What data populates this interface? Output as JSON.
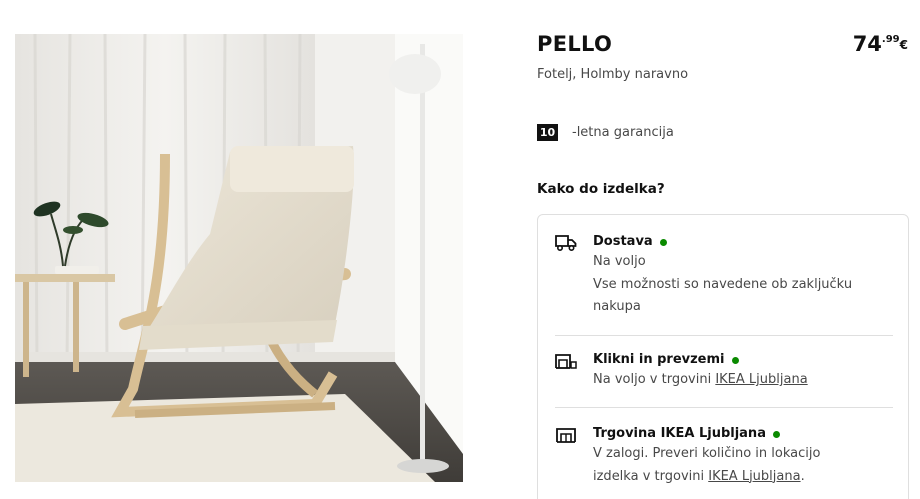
{
  "product": {
    "name": "PELLO",
    "description": "Fotelj, Holmby naravno",
    "price": {
      "integer": "74",
      "decimal": ".99",
      "currency": "€"
    },
    "image_alt": "product-photo-armchair"
  },
  "warranty": {
    "years": "10",
    "text": "-letna garancija"
  },
  "availability": {
    "heading": "Kako do izdelka?",
    "status_color": "#0a8a00",
    "options": [
      {
        "icon": "truck-icon",
        "title": "Dostava",
        "status": "available",
        "line1": "Na voljo",
        "line2": "Vse možnosti so navedene ob zaključku",
        "line3": "nakupa"
      },
      {
        "icon": "click-collect-icon",
        "title": "Klikni in prevzemi",
        "status": "available",
        "line1_prefix": "Na voljo v trgovini ",
        "line1_link": "IKEA Ljubljana"
      },
      {
        "icon": "store-icon",
        "title": "Trgovina IKEA Ljubljana",
        "status": "available",
        "line1": "V zalogi. Preveri količino in lokacijo",
        "line2_prefix": "izdelka v trgovini ",
        "line2_link": "IKEA Ljubljana",
        "line2_suffix": "."
      }
    ]
  }
}
